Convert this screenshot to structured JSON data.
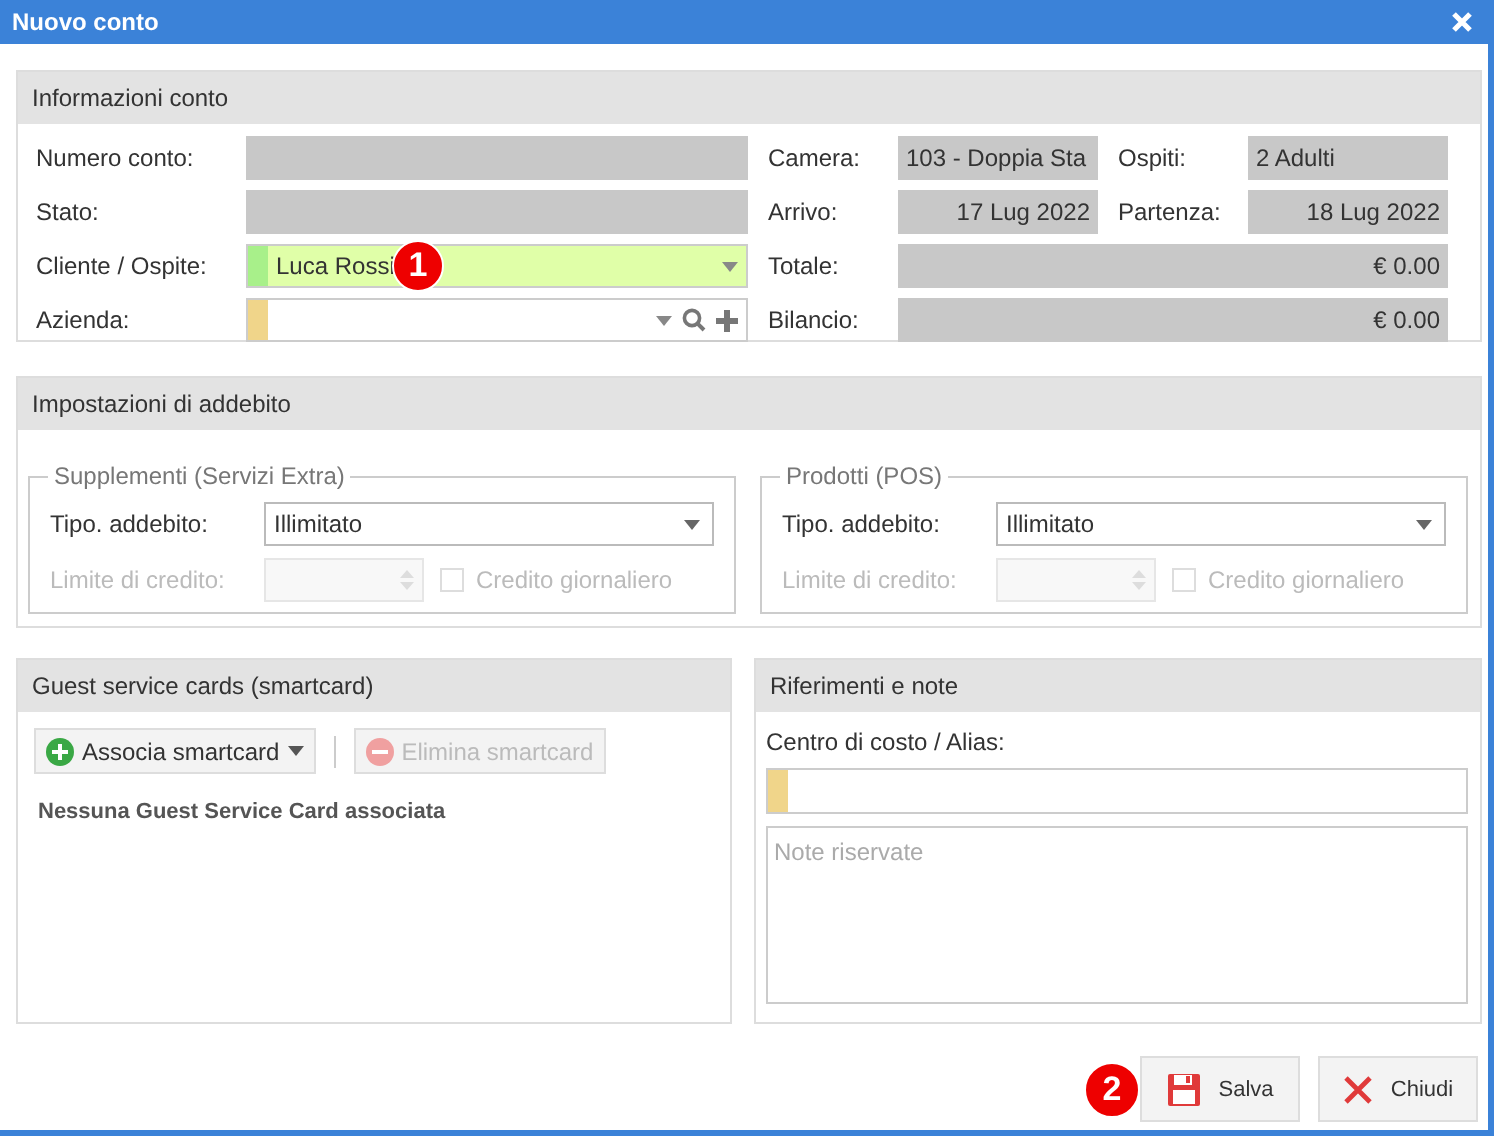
{
  "window": {
    "title": "Nuovo conto"
  },
  "account_info": {
    "title": "Informazioni conto",
    "left_fields": [
      {
        "label": "Numero conto:",
        "kind": "readonly"
      },
      {
        "label": "Stato:",
        "kind": "readonly"
      },
      {
        "label": "Cliente / Ospite:",
        "kind": "combo",
        "value": "Luca Rossi",
        "color": "#a8f08a",
        "filled": true,
        "callout": "1"
      },
      {
        "label": "Azienda:",
        "kind": "lookup",
        "color": "#f0d58a",
        "filled": false
      }
    ],
    "right_rows": [
      {
        "cells": [
          {
            "label": "Camera:",
            "value": "103 - Doppia Sta",
            "kind": "text"
          },
          {
            "label": "Ospiti:",
            "value": "2 Adulti",
            "kind": "text"
          }
        ]
      },
      {
        "cells": [
          {
            "label": "Arrivo:",
            "value": "17 Lug 2022",
            "kind": "date"
          },
          {
            "label": "Partenza:",
            "value": "18 Lug 2022",
            "kind": "date"
          }
        ]
      },
      {
        "cells": [
          {
            "label": "Totale:",
            "value": "€ 0.00",
            "kind": "amount"
          }
        ]
      },
      {
        "cells": [
          {
            "label": "Bilancio:",
            "value": "€ 0.00",
            "kind": "amount"
          }
        ]
      }
    ]
  },
  "charge_settings": {
    "title": "Impostazioni di addebito",
    "groups": [
      {
        "title": "Supplementi (Servizi Extra)",
        "type_label": "Tipo. addebito:",
        "type_value": "Illimitato",
        "limit_label": "Limite di credito:",
        "limit_disabled": true,
        "daily_label": "Credito giornaliero",
        "daily_checked": false
      },
      {
        "title": "Prodotti (POS)",
        "type_label": "Tipo. addebito:",
        "type_value": "Illimitato",
        "limit_label": "Limite di credito:",
        "limit_disabled": true,
        "daily_label": "Credito giornaliero",
        "daily_checked": false
      }
    ]
  },
  "smartcards": {
    "title": "Guest service cards (smartcard)",
    "buttons": [
      {
        "label": "Associa smartcard",
        "kind": "add",
        "disabled": false,
        "menu": true
      },
      {
        "label": "Elimina smartcard",
        "kind": "remove",
        "disabled": true,
        "menu": false
      }
    ],
    "empty_text": "Nessuna Guest Service Card associata"
  },
  "references": {
    "title": "Riferimenti e note",
    "cost_center_label": "Centro di costo / Alias:",
    "notes_placeholder": "Note riservate"
  },
  "footer": {
    "buttons": [
      {
        "label": "Salva",
        "kind": "save",
        "callout": "2"
      },
      {
        "label": "Chiudi",
        "kind": "close"
      }
    ]
  }
}
